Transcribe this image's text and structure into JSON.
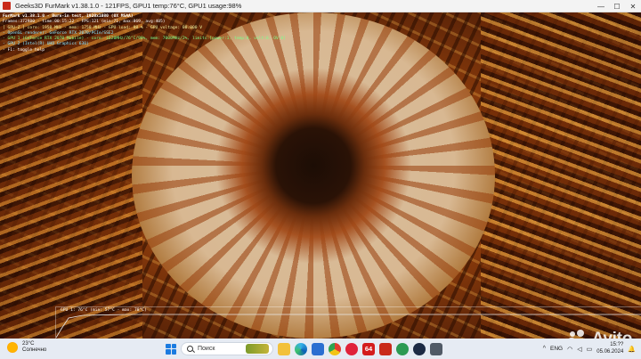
{
  "window": {
    "title": "Geeks3D FurMark v1.38.1.0 - 121FPS, GPU1 temp:76°C, GPU1 usage:98%",
    "minimize_glyph": "—",
    "maximize_glyph": "☐",
    "close_glyph": "✕"
  },
  "overlay": {
    "lines": [
      "FurMark v1.38.1.0 - Burn-in test, 1920x1080 (0X MSAA)",
      "Frames:372980 - time:00:15:22 - FPS:121 (min:71, max:869, avg:405)",
      "[ GPU-Z ] core: 1950 MHz - mem: 1750 MHz - GPU load: 98 % - GPU voltage: 00.000 V",
      "- OpenGL renderer: GeForce RTX 2070/PCIe/SSE2",
      "- GPU 1 (GeForce RTX 2070 Mobile) - core: 1620MHz/76°C/98%, mem: 7000MHz/2%, limits:[power:1, temp:0, volt:0, OV:0]",
      "- GPU 2 (Intel(R) UHD Graphics 630)",
      "- F1: toggle help"
    ]
  },
  "graph": {
    "label": "GPU 1: 76°C (min: 57°C - max: 78°C)",
    "line_color": "#e8e8e8"
  },
  "watermark": {
    "text": "Avito"
  },
  "taskbar": {
    "weather_temp": "23°C",
    "weather_desc": "Солнечно",
    "search_label": "Поиск",
    "pinned": [
      {
        "name": "file-explorer-icon",
        "label": ""
      },
      {
        "name": "edge-icon",
        "label": ""
      },
      {
        "name": "store-icon",
        "label": ""
      },
      {
        "name": "chrome-icon",
        "label": ""
      },
      {
        "name": "opera-icon",
        "label": ""
      },
      {
        "name": "aida64-icon",
        "label": "64"
      },
      {
        "name": "furmark-icon",
        "label": ""
      },
      {
        "name": "green-app-icon",
        "label": ""
      },
      {
        "name": "steam-icon",
        "label": ""
      },
      {
        "name": "gray-app-icon",
        "label": ""
      }
    ],
    "tray_chevron": "^",
    "language": "ENG",
    "wifi_glyph": "◠",
    "speaker_glyph": "◁",
    "battery_glyph": "▭",
    "time": "15:??",
    "date": "05.06.2024",
    "bell_glyph": "🔔"
  },
  "colors": {
    "titlebar_bg": "#f3f3f3",
    "taskbar_bg": "#e6ebf3",
    "overlay_cyan": "#8fe8ff",
    "overlay_green": "#7dff8a",
    "overlay_yellow": "#f4f4a0"
  }
}
